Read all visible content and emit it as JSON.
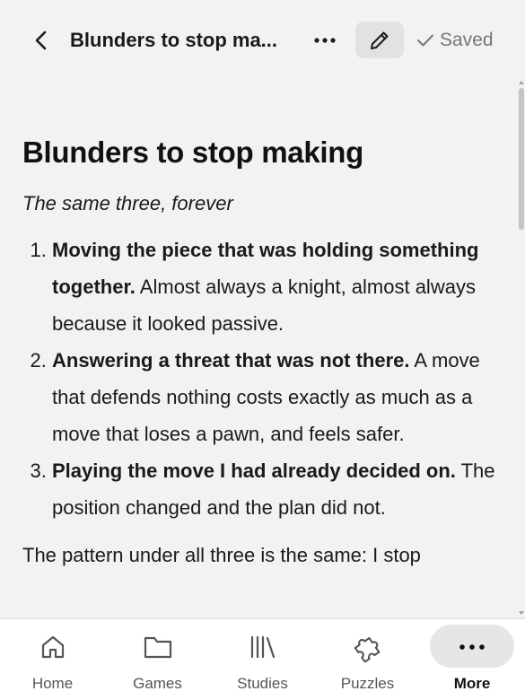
{
  "header": {
    "back_icon": "chevron-left-icon",
    "title": "Blunders to stop ma...",
    "more_icon": "more-horizontal-icon",
    "edit_icon": "pencil-icon",
    "saved_icon": "check-icon",
    "saved_label": "Saved"
  },
  "document": {
    "heading": "Blunders to stop making",
    "subtitle": "The same three, forever",
    "items": [
      {
        "bold": "Moving the piece that was holding something together.",
        "text": " Almost always a knight, almost always because it looked passive."
      },
      {
        "bold": "Answering a threat that was not there.",
        "text": " A move that defends nothing costs exactly as much as a move that loses a pawn, and feels safer."
      },
      {
        "bold": "Playing the move I had already decided on.",
        "text": " The position changed and the plan did not."
      }
    ],
    "closing": "The pattern under all three is the same: I stop"
  },
  "bottom_nav": {
    "items": [
      {
        "label": "Home",
        "icon": "home-icon"
      },
      {
        "label": "Games",
        "icon": "folder-icon"
      },
      {
        "label": "Studies",
        "icon": "library-icon"
      },
      {
        "label": "Puzzles",
        "icon": "puzzle-icon"
      },
      {
        "label": "More",
        "icon": "more-horizontal-icon",
        "active": true
      }
    ]
  },
  "colors": {
    "background": "#f2f2f2",
    "nav_background": "#ffffff",
    "active_pill": "#e6e6e6",
    "muted_text": "#777777"
  }
}
